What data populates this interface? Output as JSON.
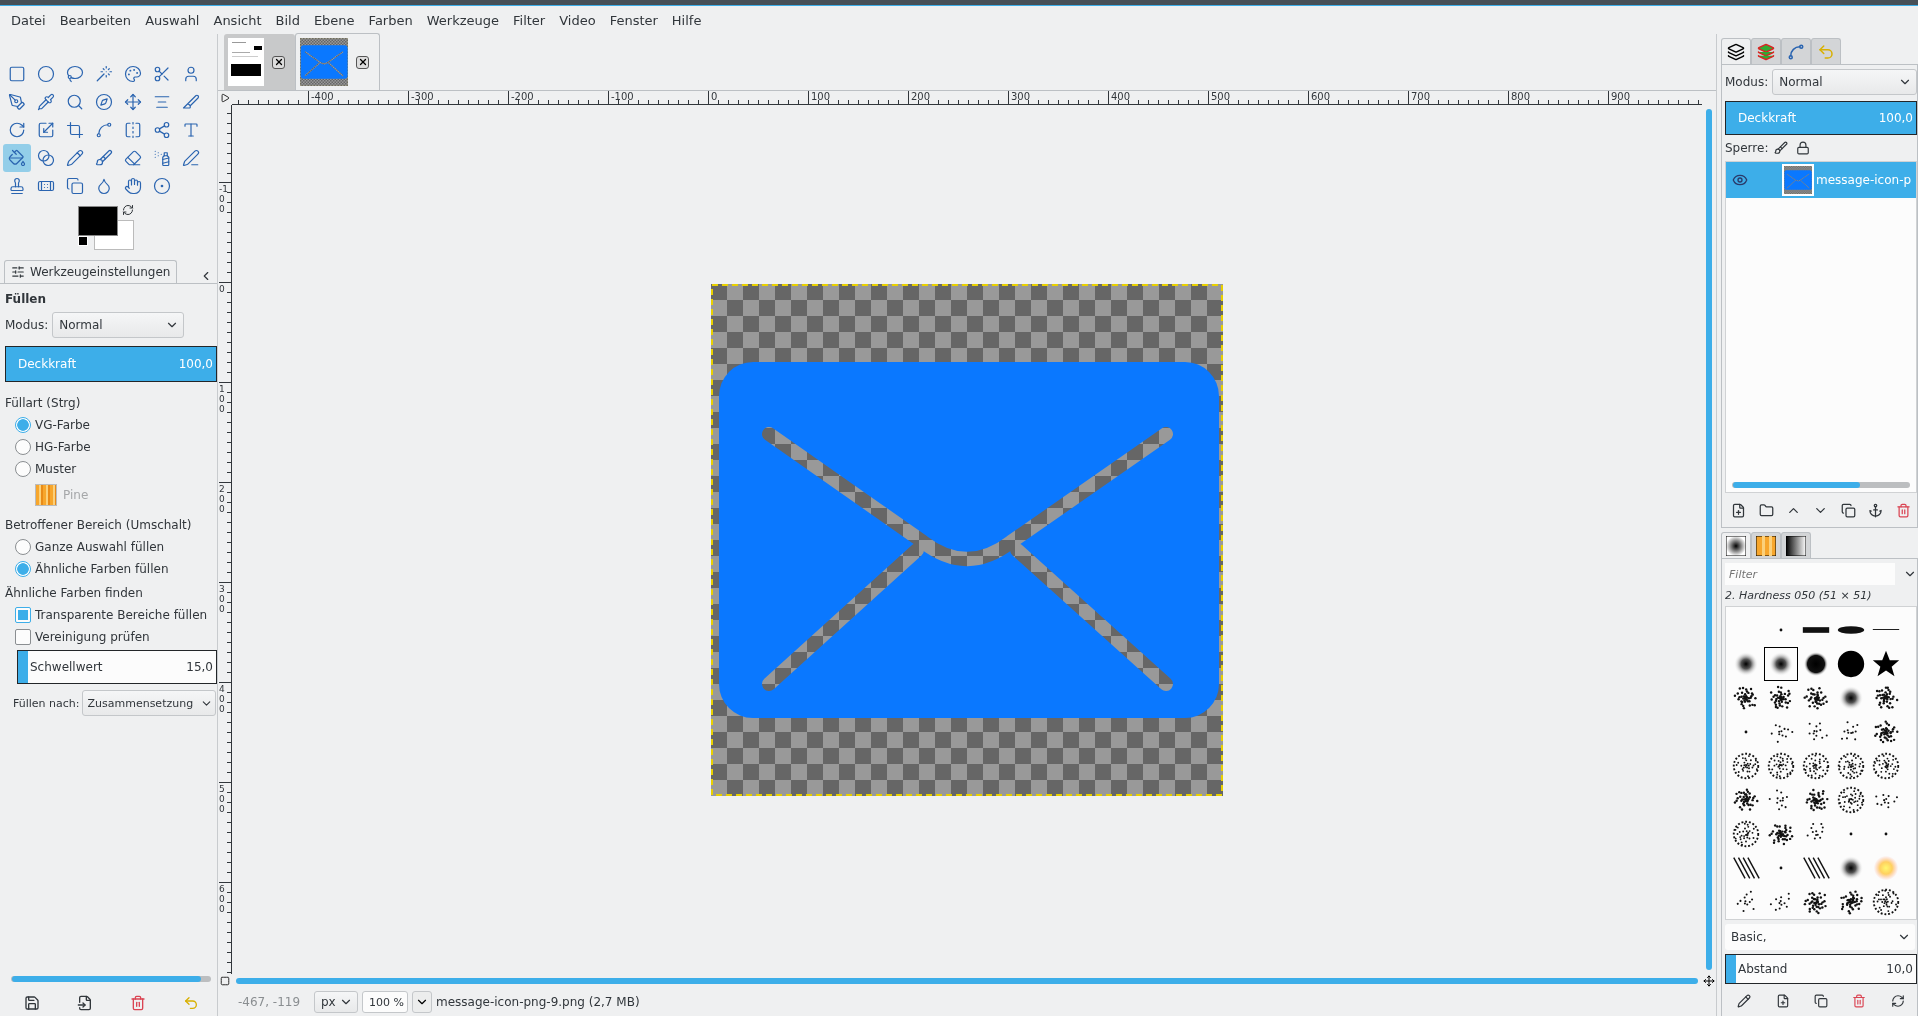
{
  "menu": [
    "Datei",
    "Bearbeiten",
    "Auswahl",
    "Ansicht",
    "Bild",
    "Ebene",
    "Farben",
    "Werkzeuge",
    "Filter",
    "Video",
    "Fenster",
    "Hilfe"
  ],
  "toolbox": {
    "tools": [
      {
        "kind": "rectangle",
        "selected": false
      },
      {
        "kind": "ellipse",
        "selected": false
      },
      {
        "kind": "lasso",
        "selected": false
      },
      {
        "kind": "wand",
        "selected": false
      },
      {
        "kind": "palette",
        "selected": false
      },
      {
        "kind": "scissors",
        "selected": false
      },
      {
        "kind": "person",
        "selected": false
      },
      {
        "kind": "pen-nib",
        "selected": false
      },
      {
        "kind": "pipette",
        "selected": false
      },
      {
        "kind": "search",
        "selected": false
      },
      {
        "kind": "compass",
        "selected": false
      },
      {
        "kind": "move-arrows",
        "selected": false
      },
      {
        "kind": "align",
        "selected": false
      },
      {
        "kind": "knife",
        "selected": false
      },
      {
        "kind": "rotate",
        "selected": false
      },
      {
        "kind": "scale",
        "selected": false
      },
      {
        "kind": "crop",
        "selected": false
      },
      {
        "kind": "spline",
        "selected": false
      },
      {
        "kind": "flip",
        "selected": false
      },
      {
        "kind": "nodes",
        "selected": false
      },
      {
        "kind": "text",
        "selected": false
      },
      {
        "kind": "paint-bucket",
        "selected": true
      },
      {
        "kind": "gradient",
        "selected": false
      },
      {
        "kind": "pencil",
        "selected": false
      },
      {
        "kind": "brush",
        "selected": false
      },
      {
        "kind": "eraser",
        "selected": false
      },
      {
        "kind": "spray-can",
        "selected": false
      },
      {
        "kind": "pen",
        "selected": false
      },
      {
        "kind": "stamp",
        "selected": false
      },
      {
        "kind": "bandage",
        "selected": false
      },
      {
        "kind": "copy",
        "selected": false
      },
      {
        "kind": "droplet",
        "selected": false
      },
      {
        "kind": "hand",
        "selected": false
      },
      {
        "kind": "dodge",
        "selected": false
      }
    ]
  },
  "tool_options": {
    "tab": "Werkzeugeinstellungen",
    "title": "Füllen",
    "mode_label": "Modus:",
    "mode": "Normal",
    "opacity": {
      "label": "Deckkraft",
      "reading": "100,0",
      "level": 1
    },
    "fill_type": {
      "label": "Füllart  (Strg)",
      "options": [
        {
          "label": "VG-Farbe",
          "selected": true
        },
        {
          "label": "HG-Farbe",
          "selected": false
        },
        {
          "label": "Muster",
          "selected": false
        }
      ]
    },
    "pattern_name": "Pine",
    "area": {
      "label": "Betroffener Bereich (Umschalt)",
      "options": [
        {
          "label": "Ganze Auswahl füllen",
          "selected": false
        },
        {
          "label": "Ähnliche Farben füllen",
          "selected": true
        }
      ]
    },
    "find": {
      "label": "Ähnliche Farben finden",
      "checks": [
        {
          "label": "Transparente Bereiche füllen",
          "checked": true
        },
        {
          "label": "Vereinigung prüfen",
          "checked": false
        }
      ],
      "threshold": {
        "label": "Schwellwert",
        "reading": "15,0",
        "level": 0.05
      },
      "fill_by_label": "Füllen nach:",
      "fill_by": "Zusammensetzung"
    }
  },
  "image_tabs": [
    {
      "kind": "document",
      "selected": false
    },
    {
      "kind": "envelope",
      "selected": true
    }
  ],
  "rulers": {
    "horizontal": [
      "-400",
      "-300",
      "-200",
      "-100",
      "0",
      "100",
      "200",
      "300",
      "400",
      "500",
      "600",
      "700",
      "800",
      "900"
    ],
    "vertical": [
      "-100",
      "0",
      "100",
      "200",
      "300",
      "400",
      "500",
      "600"
    ]
  },
  "status_bar": {
    "pointer": "-467, -119",
    "unit": "px",
    "zoom": "100 %",
    "file": "message-icon-png-9.png (2,7 MB)"
  },
  "layers_panel": {
    "tabs": [
      {
        "kind": "layers",
        "selected": true
      },
      {
        "kind": "channels",
        "selected": false
      },
      {
        "kind": "paths",
        "selected": false
      },
      {
        "kind": "undo",
        "selected": false
      }
    ],
    "mode_label": "Modus:",
    "mode": "Normal",
    "opacity": {
      "label": "Deckkraft",
      "reading": "100,0",
      "level": 1
    },
    "lock_label": "Sperre:",
    "layers": [
      {
        "name": "message-icon-p",
        "visible": true,
        "selected": true
      }
    ]
  },
  "brushes_panel": {
    "tabs": [
      {
        "kind": "brushes",
        "selected": true
      },
      {
        "kind": "patterns",
        "selected": false
      },
      {
        "kind": "gradients",
        "selected": false
      }
    ],
    "filter_placeholder": "Filter",
    "brush_name": "2. Hardness 050 (51 × 51)",
    "tag": "Basic,",
    "spacing": {
      "label": "Abstand",
      "reading": "10,0",
      "level": 0.05
    },
    "brushes": [
      {
        "kind": "blank",
        "selected": false
      },
      {
        "kind": "dot",
        "selected": false
      },
      {
        "kind": "bar",
        "selected": false
      },
      {
        "kind": "ellipse",
        "selected": false
      },
      {
        "kind": "line",
        "selected": false
      },
      {
        "kind": "soft",
        "selected": false
      },
      {
        "kind": "soft",
        "selected": true
      },
      {
        "kind": "hard",
        "selected": false
      },
      {
        "kind": "circle",
        "selected": false
      },
      {
        "kind": "star",
        "selected": false
      },
      {
        "kind": "scatter",
        "selected": false
      },
      {
        "kind": "scatter",
        "selected": false
      },
      {
        "kind": "scatter",
        "selected": false
      },
      {
        "kind": "soft",
        "selected": false
      },
      {
        "kind": "scatter",
        "selected": false
      },
      {
        "kind": "dot",
        "selected": false
      },
      {
        "kind": "sparse",
        "selected": false
      },
      {
        "kind": "sparse",
        "selected": false
      },
      {
        "kind": "sparse",
        "selected": false
      },
      {
        "kind": "scatter",
        "selected": false
      },
      {
        "kind": "texture",
        "selected": false
      },
      {
        "kind": "texture",
        "selected": false
      },
      {
        "kind": "texture",
        "selected": false
      },
      {
        "kind": "texture",
        "selected": false
      },
      {
        "kind": "texture",
        "selected": false
      },
      {
        "kind": "scatter",
        "selected": false
      },
      {
        "kind": "sparse",
        "selected": false
      },
      {
        "kind": "scatter",
        "selected": false
      },
      {
        "kind": "texture",
        "selected": false
      },
      {
        "kind": "sparse",
        "selected": false
      },
      {
        "kind": "texture",
        "selected": false
      },
      {
        "kind": "scatter",
        "selected": false
      },
      {
        "kind": "sparse",
        "selected": false
      },
      {
        "kind": "dot",
        "selected": false
      },
      {
        "kind": "dot",
        "selected": false
      },
      {
        "kind": "stripes",
        "selected": false
      },
      {
        "kind": "dot",
        "selected": false
      },
      {
        "kind": "stripes",
        "selected": false
      },
      {
        "kind": "soft",
        "selected": false
      },
      {
        "kind": "glow",
        "selected": false
      },
      {
        "kind": "sparse",
        "selected": false
      },
      {
        "kind": "sparse",
        "selected": false
      },
      {
        "kind": "scatter",
        "selected": false
      },
      {
        "kind": "scatter",
        "selected": false
      },
      {
        "kind": "texture",
        "selected": false
      }
    ]
  }
}
